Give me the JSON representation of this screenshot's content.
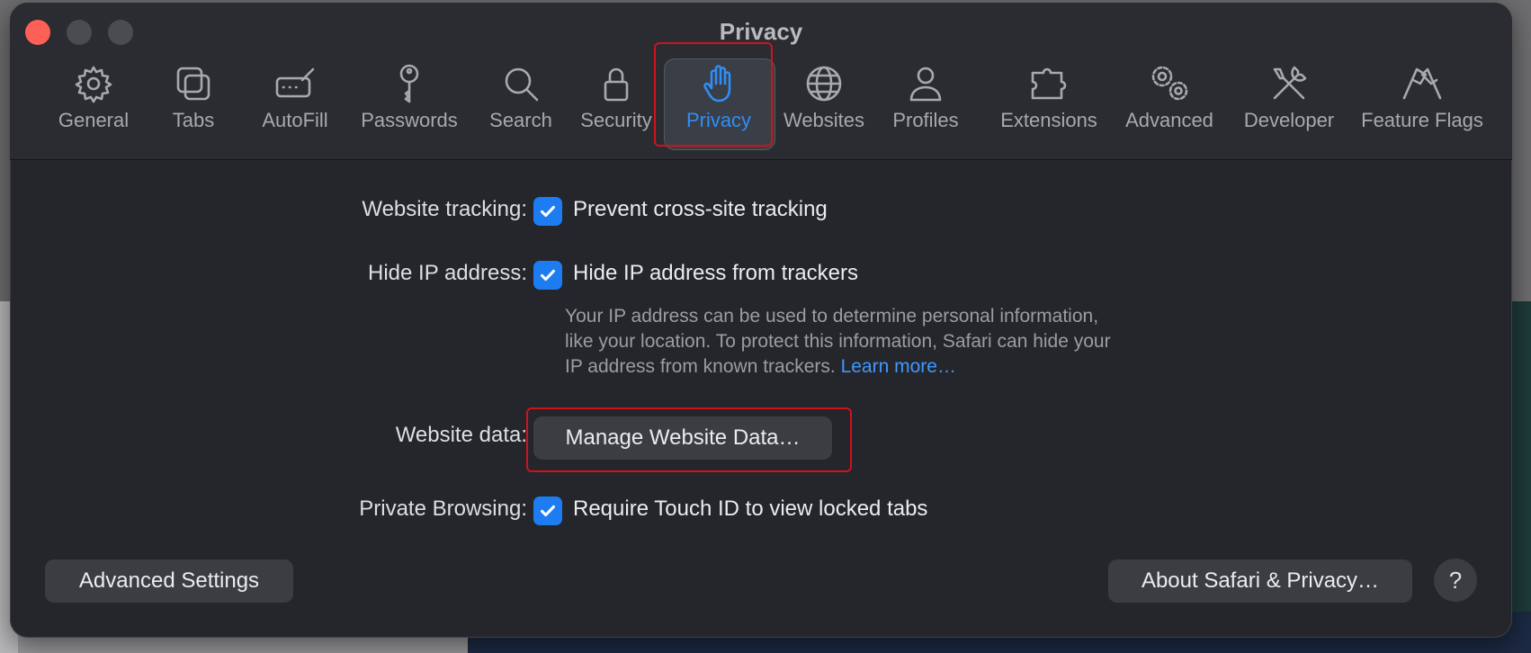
{
  "window": {
    "title": "Privacy"
  },
  "toolbar": {
    "tabs": [
      {
        "label": "General",
        "icon": "gear-icon"
      },
      {
        "label": "Tabs",
        "icon": "tabs-icon"
      },
      {
        "label": "AutoFill",
        "icon": "autofill-icon"
      },
      {
        "label": "Passwords",
        "icon": "key-icon"
      },
      {
        "label": "Search",
        "icon": "search-icon"
      },
      {
        "label": "Security",
        "icon": "lock-icon"
      },
      {
        "label": "Privacy",
        "icon": "hand-icon",
        "selected": true
      },
      {
        "label": "Websites",
        "icon": "globe-icon"
      },
      {
        "label": "Profiles",
        "icon": "person-icon"
      },
      {
        "label": "Extensions",
        "icon": "puzzle-icon"
      },
      {
        "label": "Advanced",
        "icon": "gears-icon"
      },
      {
        "label": "Developer",
        "icon": "tools-icon"
      },
      {
        "label": "Feature Flags",
        "icon": "flags-icon"
      }
    ]
  },
  "settings": {
    "tracking": {
      "label": "Website tracking:",
      "option": "Prevent cross-site tracking",
      "checked": true
    },
    "hide_ip": {
      "label": "Hide IP address:",
      "option": "Hide IP address from trackers",
      "checked": true,
      "description_line1": "Your IP address can be used to determine personal information,",
      "description_line2": "like your location. To protect this information, Safari can hide your",
      "description_line3": "IP address from known trackers.",
      "learn_more": "Learn more…"
    },
    "website_data": {
      "label": "Website data:",
      "button": "Manage Website Data…"
    },
    "private_browsing": {
      "label": "Private Browsing:",
      "option": "Require Touch ID to view locked tabs",
      "checked": true
    }
  },
  "footer": {
    "advanced_settings": "Advanced Settings",
    "about": "About Safari & Privacy…",
    "help": "?"
  },
  "colors": {
    "accent": "#2f8ef7",
    "checkbox": "#1d7cf2",
    "highlight": "#d0121c"
  }
}
